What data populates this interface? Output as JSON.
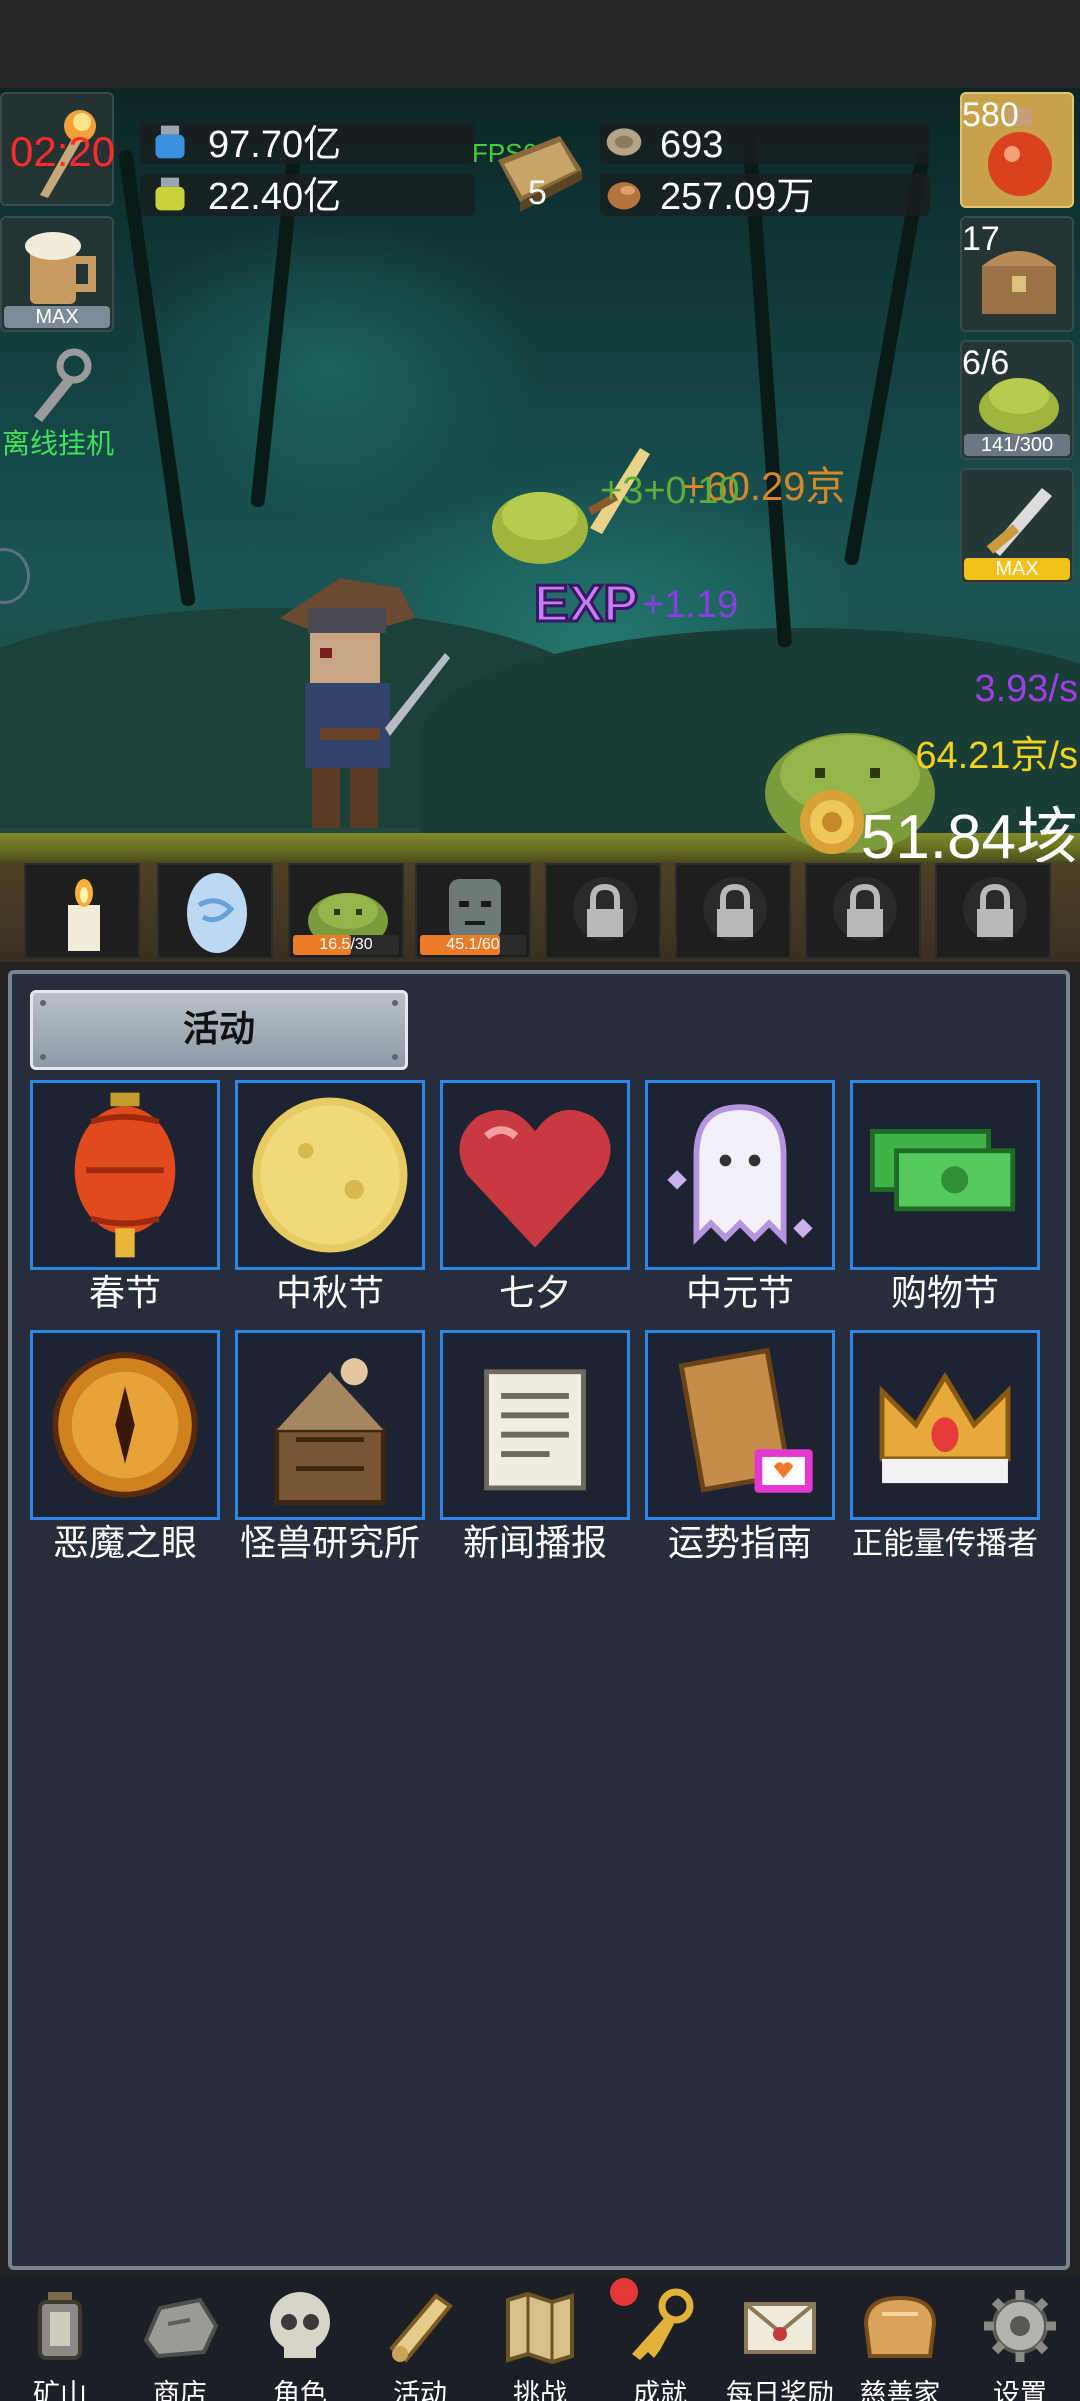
{
  "hud": {
    "timer": "02:20",
    "fps": "FPS61",
    "book_count": "5",
    "res1": "97.70亿",
    "res2": "22.40亿",
    "res3": "693",
    "res4": "257.09万",
    "potion_count": "580",
    "chest_count": "17",
    "slime_count": "6/6",
    "slime_progress": "141/300",
    "mug_max": "MAX",
    "sword_max": "MAX",
    "offline_label": "离线挂机"
  },
  "battle": {
    "floating_damage": "+60.29京",
    "floating_small": "+3+0.10",
    "exp_tag": "EXP",
    "exp_gain": "+1.19",
    "rate_purple": "3.93/s",
    "rate_yellow": "64.21京/s",
    "gold_total": "51.84垓"
  },
  "monsters": [
    {
      "name": "candle",
      "bar": ""
    },
    {
      "name": "egg",
      "bar": ""
    },
    {
      "name": "slime",
      "bar": "16.5/30",
      "fill": 0.55
    },
    {
      "name": "zombie",
      "bar": "45.1/60",
      "fill": 0.75
    },
    {
      "name": "locked",
      "bar": ""
    },
    {
      "name": "locked",
      "bar": ""
    },
    {
      "name": "locked",
      "bar": ""
    },
    {
      "name": "locked",
      "bar": ""
    }
  ],
  "panel": {
    "tab_title": "活动",
    "activities": [
      {
        "label": "春节",
        "icon": "lantern-icon"
      },
      {
        "label": "中秋节",
        "icon": "moon-icon"
      },
      {
        "label": "七夕",
        "icon": "heart-icon"
      },
      {
        "label": "中元节",
        "icon": "ghost-icon"
      },
      {
        "label": "购物节",
        "icon": "cash-icon"
      },
      {
        "label": "恶魔之眼",
        "icon": "demon-eye-icon"
      },
      {
        "label": "怪兽研究所",
        "icon": "monster-lab-icon"
      },
      {
        "label": "新闻播报",
        "icon": "newspaper-icon"
      },
      {
        "label": "运势指南",
        "icon": "fortune-icon"
      },
      {
        "label": "正能量传播者",
        "icon": "crown-icon"
      }
    ]
  },
  "nav": {
    "items": [
      {
        "label": "矿山",
        "icon": "lantern-nav-icon"
      },
      {
        "label": "商店",
        "icon": "stone-icon"
      },
      {
        "label": "角色",
        "icon": "skull-icon"
      },
      {
        "label": "活动",
        "icon": "scroll-icon"
      },
      {
        "label": "挑战",
        "icon": "map-icon"
      },
      {
        "label": "成就",
        "icon": "key-icon"
      },
      {
        "label": "每日奖励",
        "icon": "envelope-icon"
      },
      {
        "label": "慈善家",
        "icon": "bread-icon"
      },
      {
        "label": "设置",
        "icon": "gear-icon"
      }
    ]
  },
  "colors": {
    "accent_blue": "#2f86e4",
    "panel_bg": "#262d3b",
    "timer_red": "#ff2b2b",
    "fps_green": "#3fcf3f",
    "exp_purple": "#8a3de0",
    "rate_yellow": "#f2d31b",
    "damage_orange": "#d6872a"
  }
}
